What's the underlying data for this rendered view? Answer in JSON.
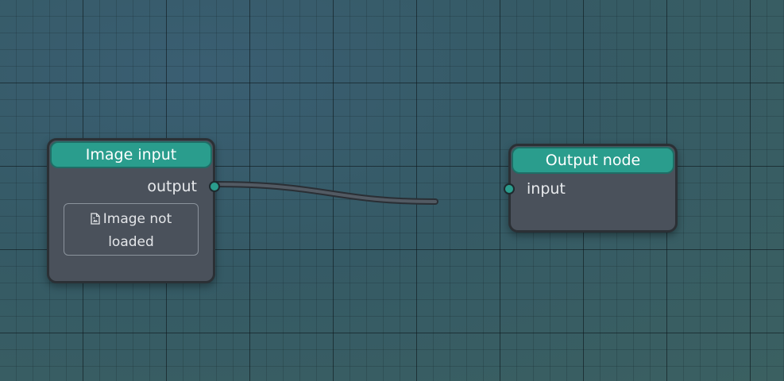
{
  "nodes": {
    "image_input": {
      "title": "Image input",
      "output_label": "output",
      "preview_line1": "Image not",
      "preview_line2": "loaded",
      "preview_icon": "file-image-icon"
    },
    "output_node": {
      "title": "Output node",
      "input_label": "input"
    }
  },
  "colors": {
    "node_header": "#2a9d8d",
    "node_body": "#4a515b",
    "canvas": "#355a65",
    "wire": "#4c535c"
  }
}
